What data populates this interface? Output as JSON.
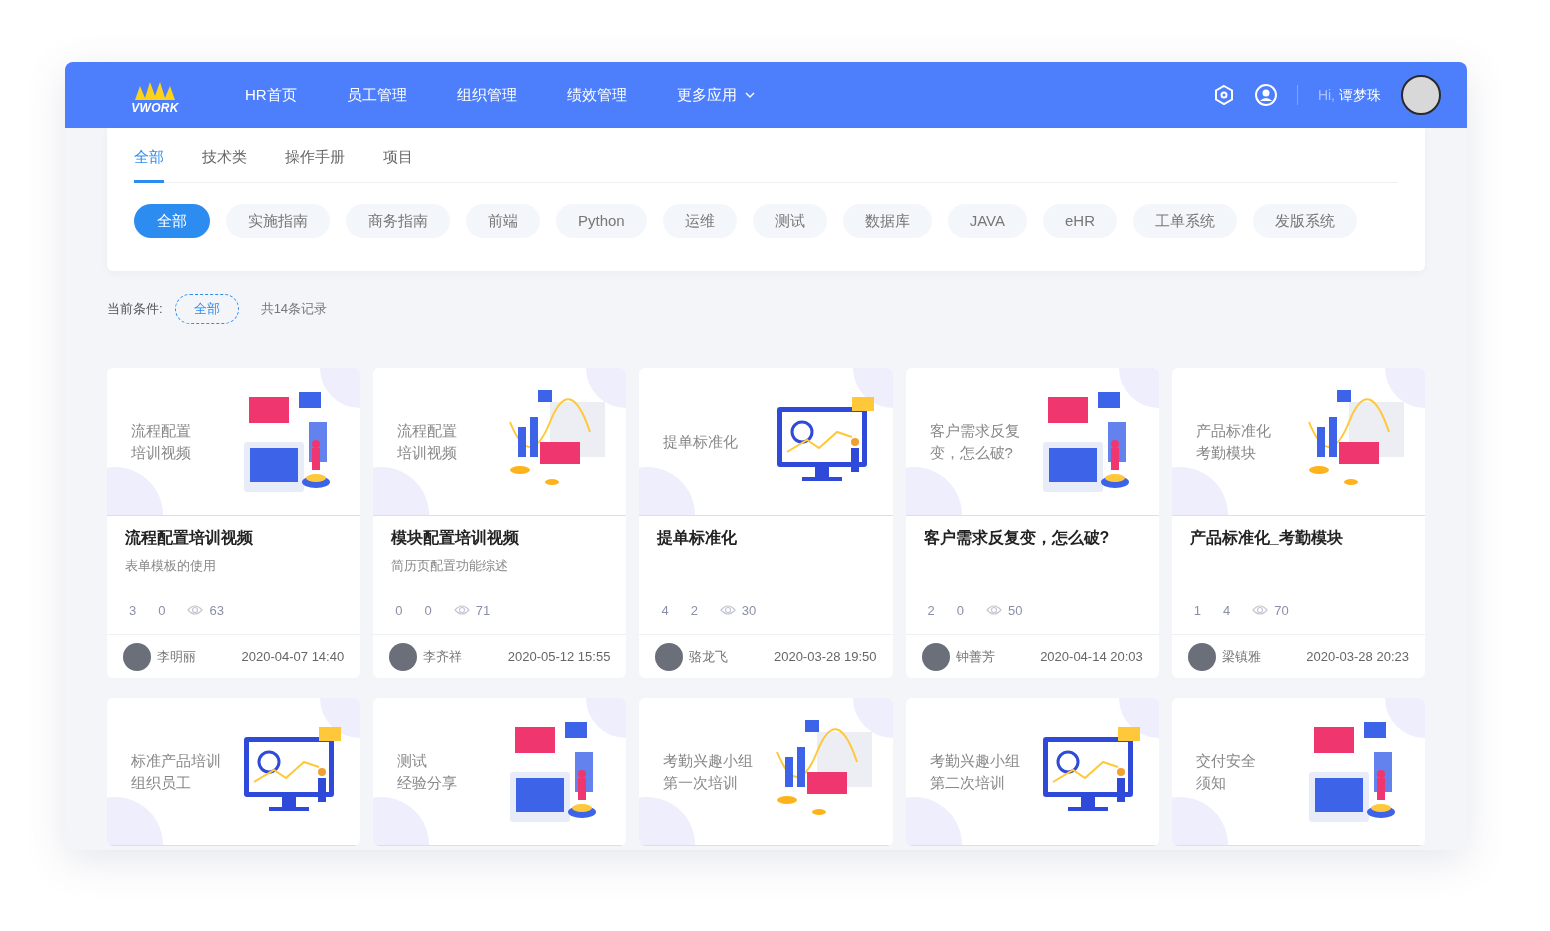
{
  "header": {
    "logo": "VWORK",
    "nav": [
      {
        "label": "HR首页",
        "dropdown": false
      },
      {
        "label": "员工管理",
        "dropdown": false
      },
      {
        "label": "组织管理",
        "dropdown": false
      },
      {
        "label": "绩效管理",
        "dropdown": false
      },
      {
        "label": "更多应用",
        "dropdown": true
      }
    ],
    "greeting": "Hi,",
    "user_name": "谭梦珠"
  },
  "category_tabs": [
    {
      "label": "全部",
      "selected": true
    },
    {
      "label": "技术类",
      "selected": false
    },
    {
      "label": "操作手册",
      "selected": false
    },
    {
      "label": "项目",
      "selected": false
    }
  ],
  "tags": [
    {
      "label": "全部",
      "selected": true
    },
    {
      "label": "实施指南",
      "selected": false
    },
    {
      "label": "商务指南",
      "selected": false
    },
    {
      "label": "前端",
      "selected": false
    },
    {
      "label": "Python",
      "selected": false
    },
    {
      "label": "运维",
      "selected": false
    },
    {
      "label": "测试",
      "selected": false
    },
    {
      "label": "数据库",
      "selected": false
    },
    {
      "label": "JAVA",
      "selected": false
    },
    {
      "label": "eHR",
      "selected": false
    },
    {
      "label": "工单系统",
      "selected": false
    },
    {
      "label": "发版系统",
      "selected": false
    }
  ],
  "filter": {
    "label": "当前条件:",
    "chip": "全部",
    "count": "共14条记录"
  },
  "cards": [
    {
      "cover_text": [
        "流程配置",
        "培训视频"
      ],
      "title": "流程配置培训视频",
      "subtitle": "表单模板的使用",
      "stats": [
        "3",
        "0"
      ],
      "views": "63",
      "author": "李明丽",
      "date": "2020-04-07 14:40"
    },
    {
      "cover_text": [
        "流程配置",
        "培训视频"
      ],
      "title": "模块配置培训视频",
      "subtitle": "简历页配置功能综述",
      "stats": [
        "0",
        "0"
      ],
      "views": "71",
      "author": "李齐祥",
      "date": "2020-05-12 15:55"
    },
    {
      "cover_text": [
        "提单标准化"
      ],
      "title": "提单标准化",
      "stats": [
        "4",
        "2"
      ],
      "views": "30",
      "author": "骆龙飞",
      "date": "2020-03-28 19:50"
    },
    {
      "cover_text": [
        "客户需求反复",
        "变，怎么破?"
      ],
      "title": "客户需求反复变，怎么破?",
      "stats": [
        "2",
        "0"
      ],
      "views": "50",
      "author": "钟善芳",
      "date": "2020-04-14 20:03"
    },
    {
      "cover_text": [
        "产品标准化",
        "考勤模块"
      ],
      "title": "产品标准化_考勤模块",
      "stats": [
        "1",
        "4"
      ],
      "views": "70",
      "author": "梁镇雅",
      "date": "2020-03-28 20:23"
    },
    {
      "cover_text": [
        "标准产品培训",
        "组织员工"
      ]
    },
    {
      "cover_text": [
        "测试",
        "经验分享"
      ]
    },
    {
      "cover_text": [
        "考勤兴趣小组",
        "第一次培训"
      ]
    },
    {
      "cover_text": [
        "考勤兴趣小组",
        "第二次培训"
      ]
    },
    {
      "cover_text": [
        "交付安全",
        "须知"
      ]
    }
  ]
}
